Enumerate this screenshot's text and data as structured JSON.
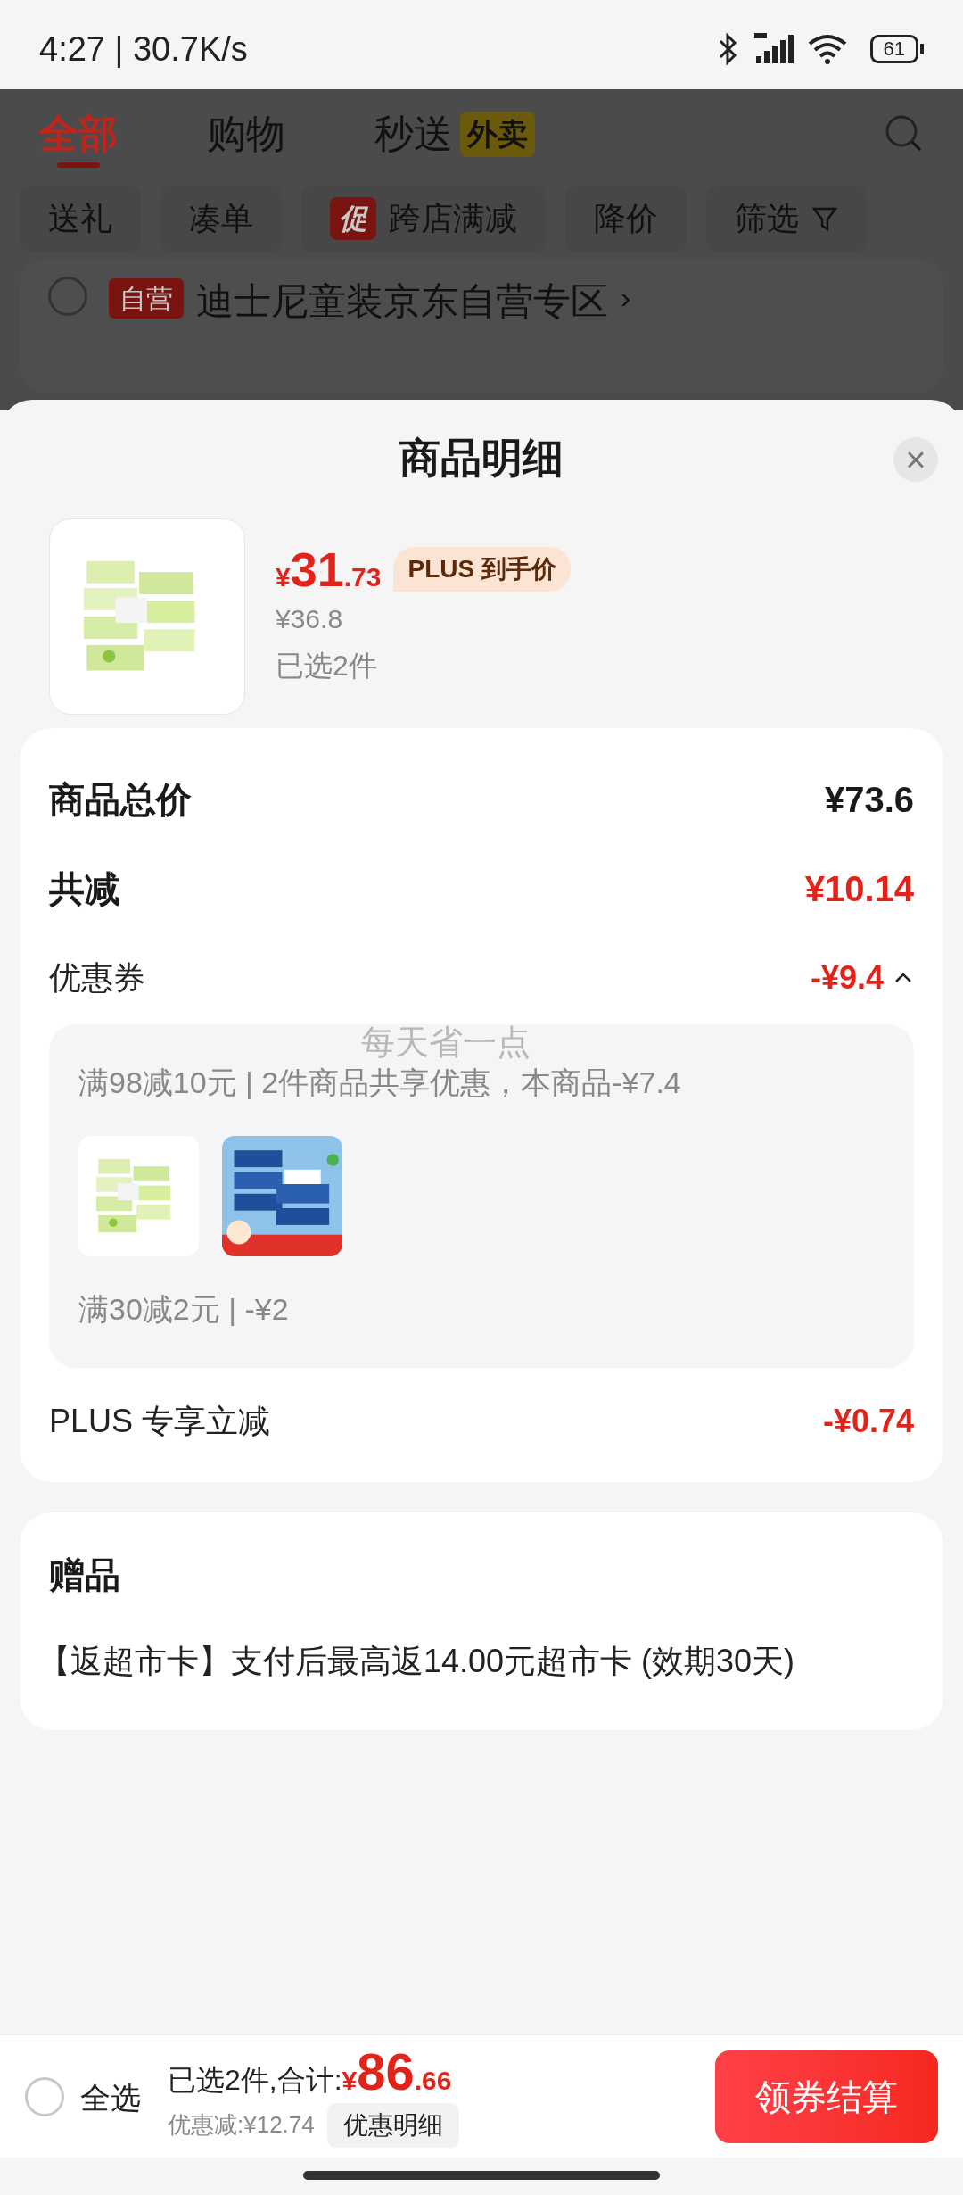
{
  "status_bar": {
    "time": "4:27 | 30.7K/s",
    "battery": "61"
  },
  "background_page": {
    "tabs": [
      {
        "label": "全部",
        "selected": true
      },
      {
        "label": "购物",
        "selected": false
      },
      {
        "label": "秒送",
        "selected": false,
        "badge": "外卖"
      }
    ],
    "filters": [
      {
        "label": "送礼"
      },
      {
        "label": "凑单"
      },
      {
        "label": "跨店满减",
        "promo": "促"
      },
      {
        "label": "降价"
      },
      {
        "label": "筛选",
        "kind": "filter"
      }
    ],
    "store": {
      "checked": false,
      "tag": "自营",
      "name": "迪士尼童装京东自营专区",
      "arrow": "›"
    }
  },
  "sheet": {
    "title": "商品明细",
    "close": "×",
    "product": {
      "price_symbol": "¥",
      "price_int": "31",
      "price_dec": ".73",
      "price_tag": "PLUS 到手价",
      "original_price": "¥36.8",
      "selected_count": "已选2件"
    },
    "summary": [
      {
        "label": "商品总价",
        "value": "¥73.6",
        "kind": "total"
      },
      {
        "label": "共减",
        "value": "¥10.14",
        "kind": "discount"
      },
      {
        "label": "优惠券",
        "value": "-¥9.4",
        "kind": "coupon",
        "expanded": true
      }
    ],
    "coupon_box": {
      "slogan": "每天省一点",
      "items": [
        {
          "text": "满98减10元 | 2件商品共享优惠，本商品-¥7.4"
        },
        {
          "text": "满30减2元 | -¥2"
        }
      ]
    },
    "plus_row": {
      "label": "PLUS 专享立减",
      "value": "-¥0.74"
    },
    "gift": {
      "title": "赠品",
      "text": "【返超市卡】支付后最高返14.00元超市卡 (效期30天)"
    }
  },
  "bottom_bar": {
    "select_all": {
      "label": "全选",
      "checked": false
    },
    "summary_prefix": "已选2件,合计:",
    "total_symbol": "¥",
    "total_int": "86",
    "total_dec": ".66",
    "saved": "优惠减:¥12.74",
    "detail_button": "优惠明细",
    "checkout_button": "领券结算"
  }
}
